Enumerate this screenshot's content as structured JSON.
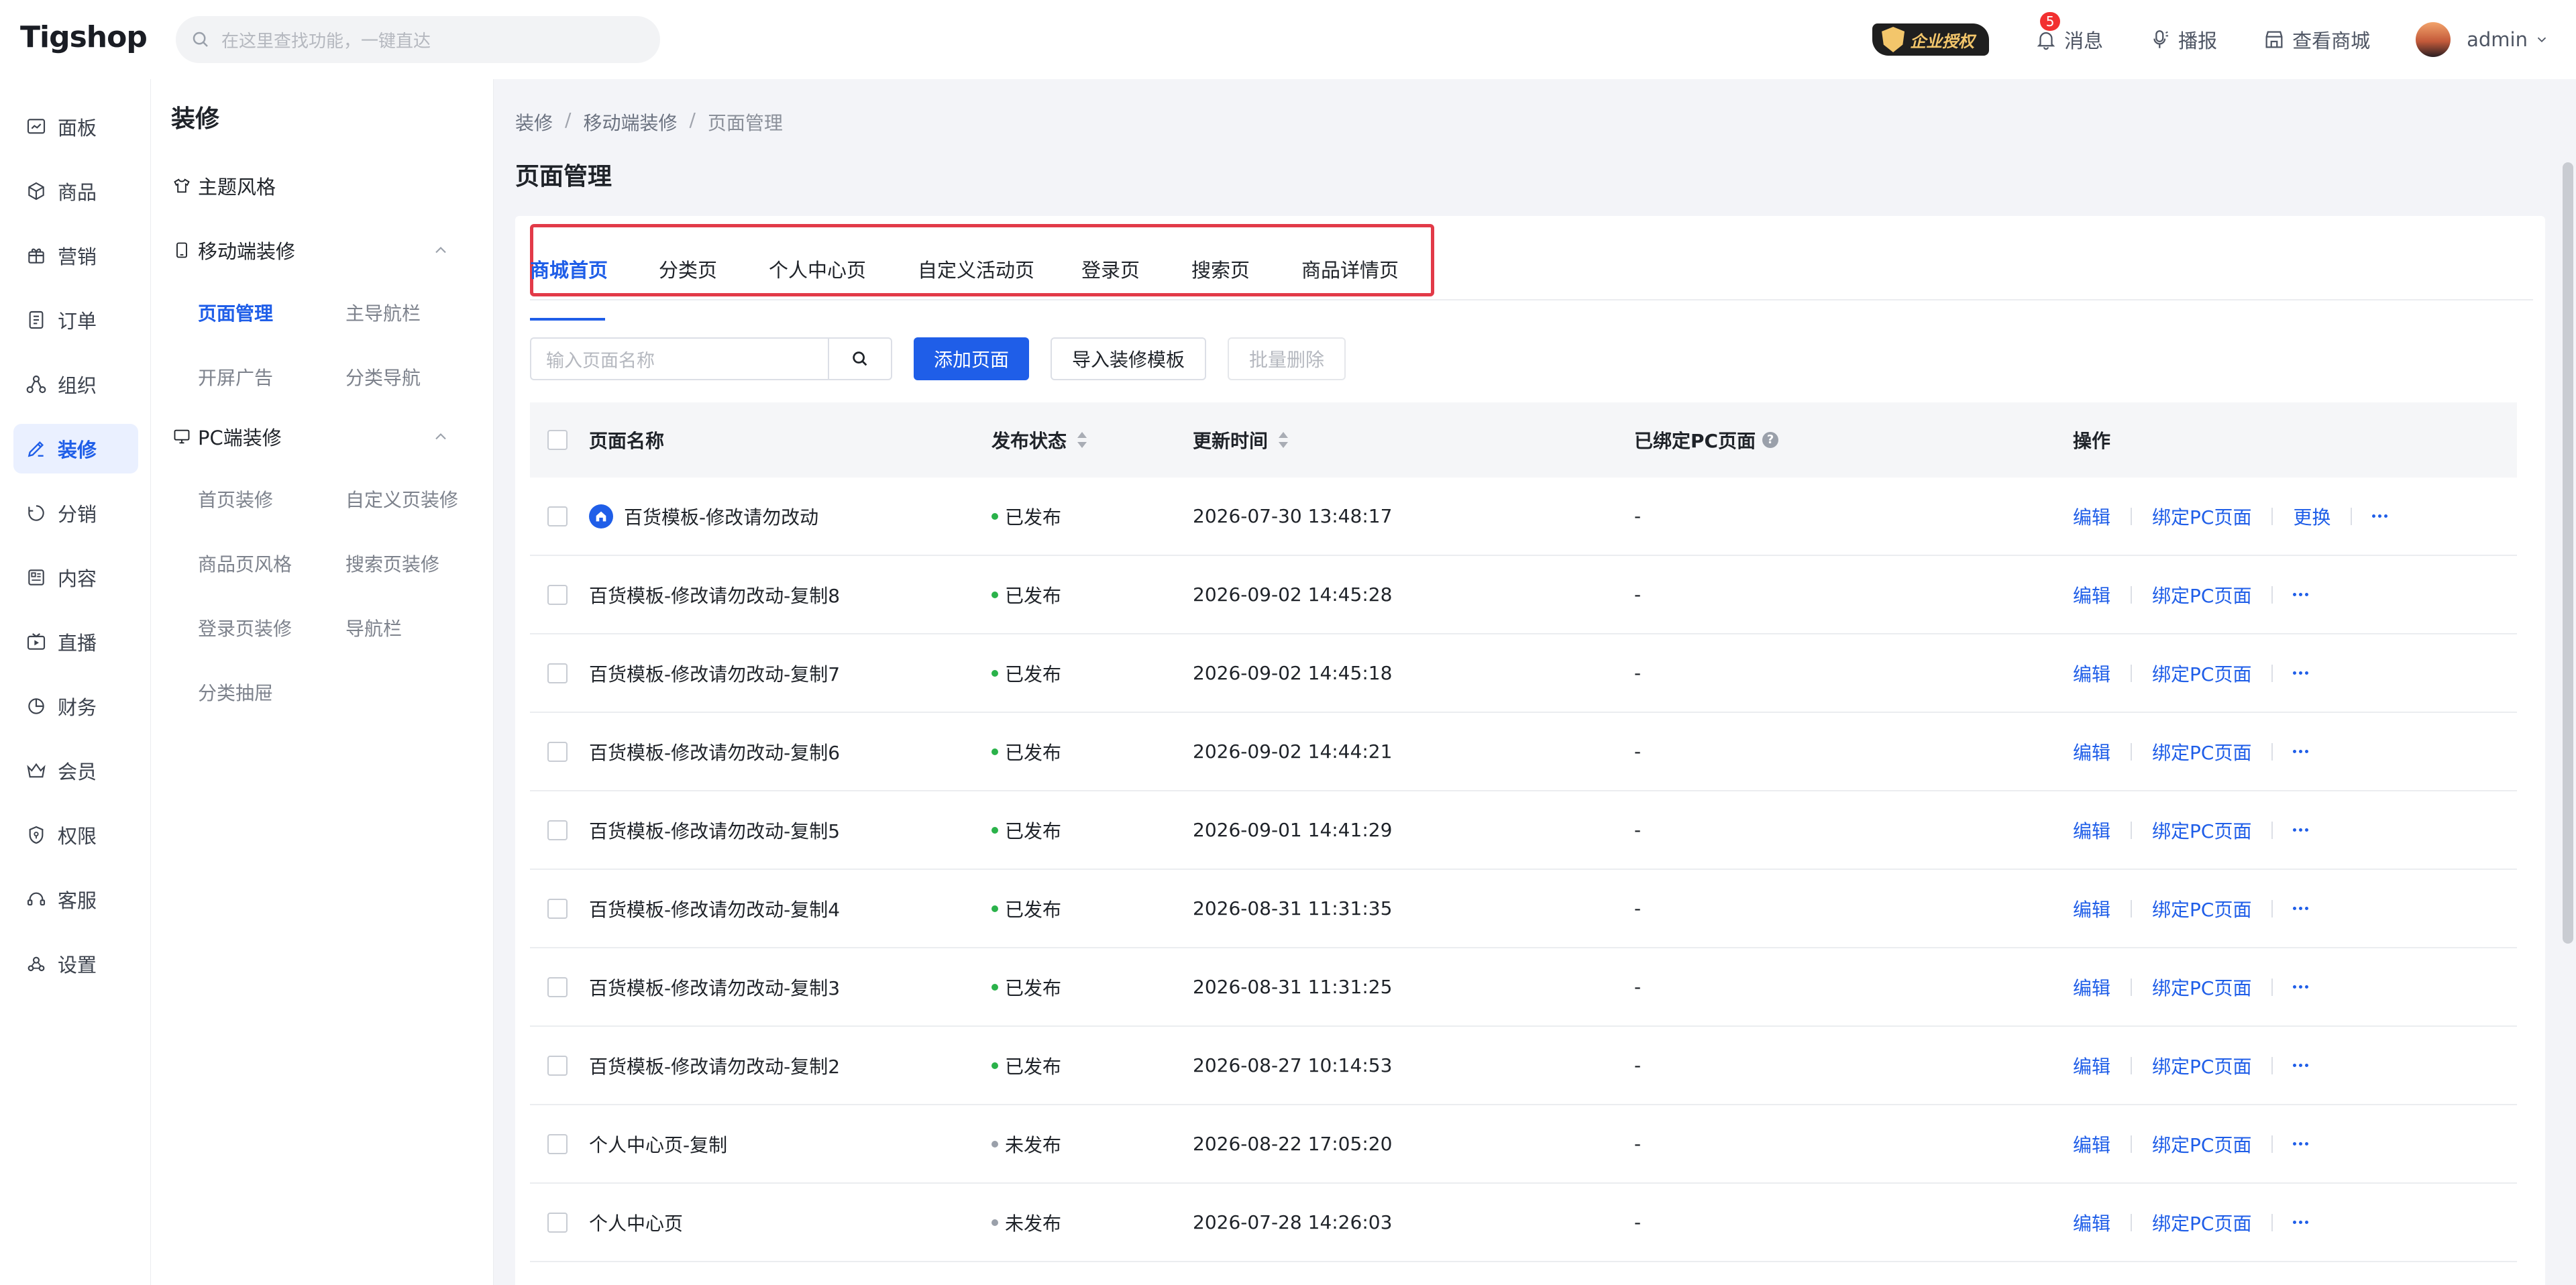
{
  "header": {
    "logo": "Tigshop",
    "search_placeholder": "在这里查找功能，一键直达",
    "enterprise_badge": "企业授权",
    "message_label": "消息",
    "message_count": "5",
    "broadcast_label": "播报",
    "view_shop_label": "查看商城",
    "user_name": "admin"
  },
  "rail": {
    "items": [
      {
        "label": "面板",
        "icon": "dashboard-icon"
      },
      {
        "label": "商品",
        "icon": "box-icon"
      },
      {
        "label": "营销",
        "icon": "marketing-icon"
      },
      {
        "label": "订单",
        "icon": "order-icon"
      },
      {
        "label": "组织",
        "icon": "org-icon"
      },
      {
        "label": "装修",
        "icon": "decorate-icon",
        "active": true
      },
      {
        "label": "分销",
        "icon": "distribution-icon"
      },
      {
        "label": "内容",
        "icon": "content-icon"
      },
      {
        "label": "直播",
        "icon": "live-icon"
      },
      {
        "label": "财务",
        "icon": "finance-icon"
      },
      {
        "label": "会员",
        "icon": "member-icon"
      },
      {
        "label": "权限",
        "icon": "permission-icon"
      },
      {
        "label": "客服",
        "icon": "service-icon"
      },
      {
        "label": "设置",
        "icon": "settings-icon"
      }
    ]
  },
  "sidebar": {
    "title": "装修",
    "theme_style": "主题风格",
    "mobile_section": "移动端装修",
    "mobile_links": [
      "页面管理",
      "主导航栏",
      "开屏广告",
      "分类导航"
    ],
    "pc_section": "PC端装修",
    "pc_links": [
      "首页装修",
      "自定义页装修",
      "商品页风格",
      "搜索页装修",
      "登录页装修",
      "导航栏",
      "分类抽屉"
    ]
  },
  "breadcrumb": [
    "装修",
    "移动端装修",
    "页面管理"
  ],
  "page_title": "页面管理",
  "tabs": [
    "商城首页",
    "分类页",
    "个人中心页",
    "自定义活动页",
    "登录页",
    "搜索页",
    "商品详情页"
  ],
  "toolbar": {
    "search_placeholder": "输入页面名称",
    "add_page": "添加页面",
    "import_template": "导入装修模板",
    "batch_delete": "批量删除"
  },
  "table": {
    "columns": [
      "页面名称",
      "发布状态",
      "更新时间",
      "已绑定PC页面",
      "操作"
    ],
    "ops": {
      "edit": "编辑",
      "bind_pc": "绑定PC页面",
      "replace": "更换"
    },
    "rows": [
      {
        "name": "百货模板-修改请勿改动",
        "status": "已发布",
        "published": true,
        "time": "2026-07-30 13:48:17",
        "pc": "-",
        "home": true
      },
      {
        "name": "百货模板-修改请勿改动-复制8",
        "status": "已发布",
        "published": true,
        "time": "2026-09-02 14:45:28",
        "pc": "-"
      },
      {
        "name": "百货模板-修改请勿改动-复制7",
        "status": "已发布",
        "published": true,
        "time": "2026-09-02 14:45:18",
        "pc": "-"
      },
      {
        "name": "百货模板-修改请勿改动-复制6",
        "status": "已发布",
        "published": true,
        "time": "2026-09-02 14:44:21",
        "pc": "-"
      },
      {
        "name": "百货模板-修改请勿改动-复制5",
        "status": "已发布",
        "published": true,
        "time": "2026-09-01 14:41:29",
        "pc": "-"
      },
      {
        "name": "百货模板-修改请勿改动-复制4",
        "status": "已发布",
        "published": true,
        "time": "2026-08-31 11:31:35",
        "pc": "-"
      },
      {
        "name": "百货模板-修改请勿改动-复制3",
        "status": "已发布",
        "published": true,
        "time": "2026-08-31 11:31:25",
        "pc": "-"
      },
      {
        "name": "百货模板-修改请勿改动-复制2",
        "status": "已发布",
        "published": true,
        "time": "2026-08-27 10:14:53",
        "pc": "-"
      },
      {
        "name": "个人中心页-复制",
        "status": "未发布",
        "published": false,
        "time": "2026-08-22 17:05:20",
        "pc": "-"
      },
      {
        "name": "个人中心页",
        "status": "未发布",
        "published": false,
        "time": "2026-07-28 14:26:03",
        "pc": "-"
      }
    ]
  },
  "colors": {
    "accent": "#1f5ee8",
    "published": "#2ab24a",
    "unpublished": "#9aa0aa",
    "highlight": "#e23a48"
  }
}
